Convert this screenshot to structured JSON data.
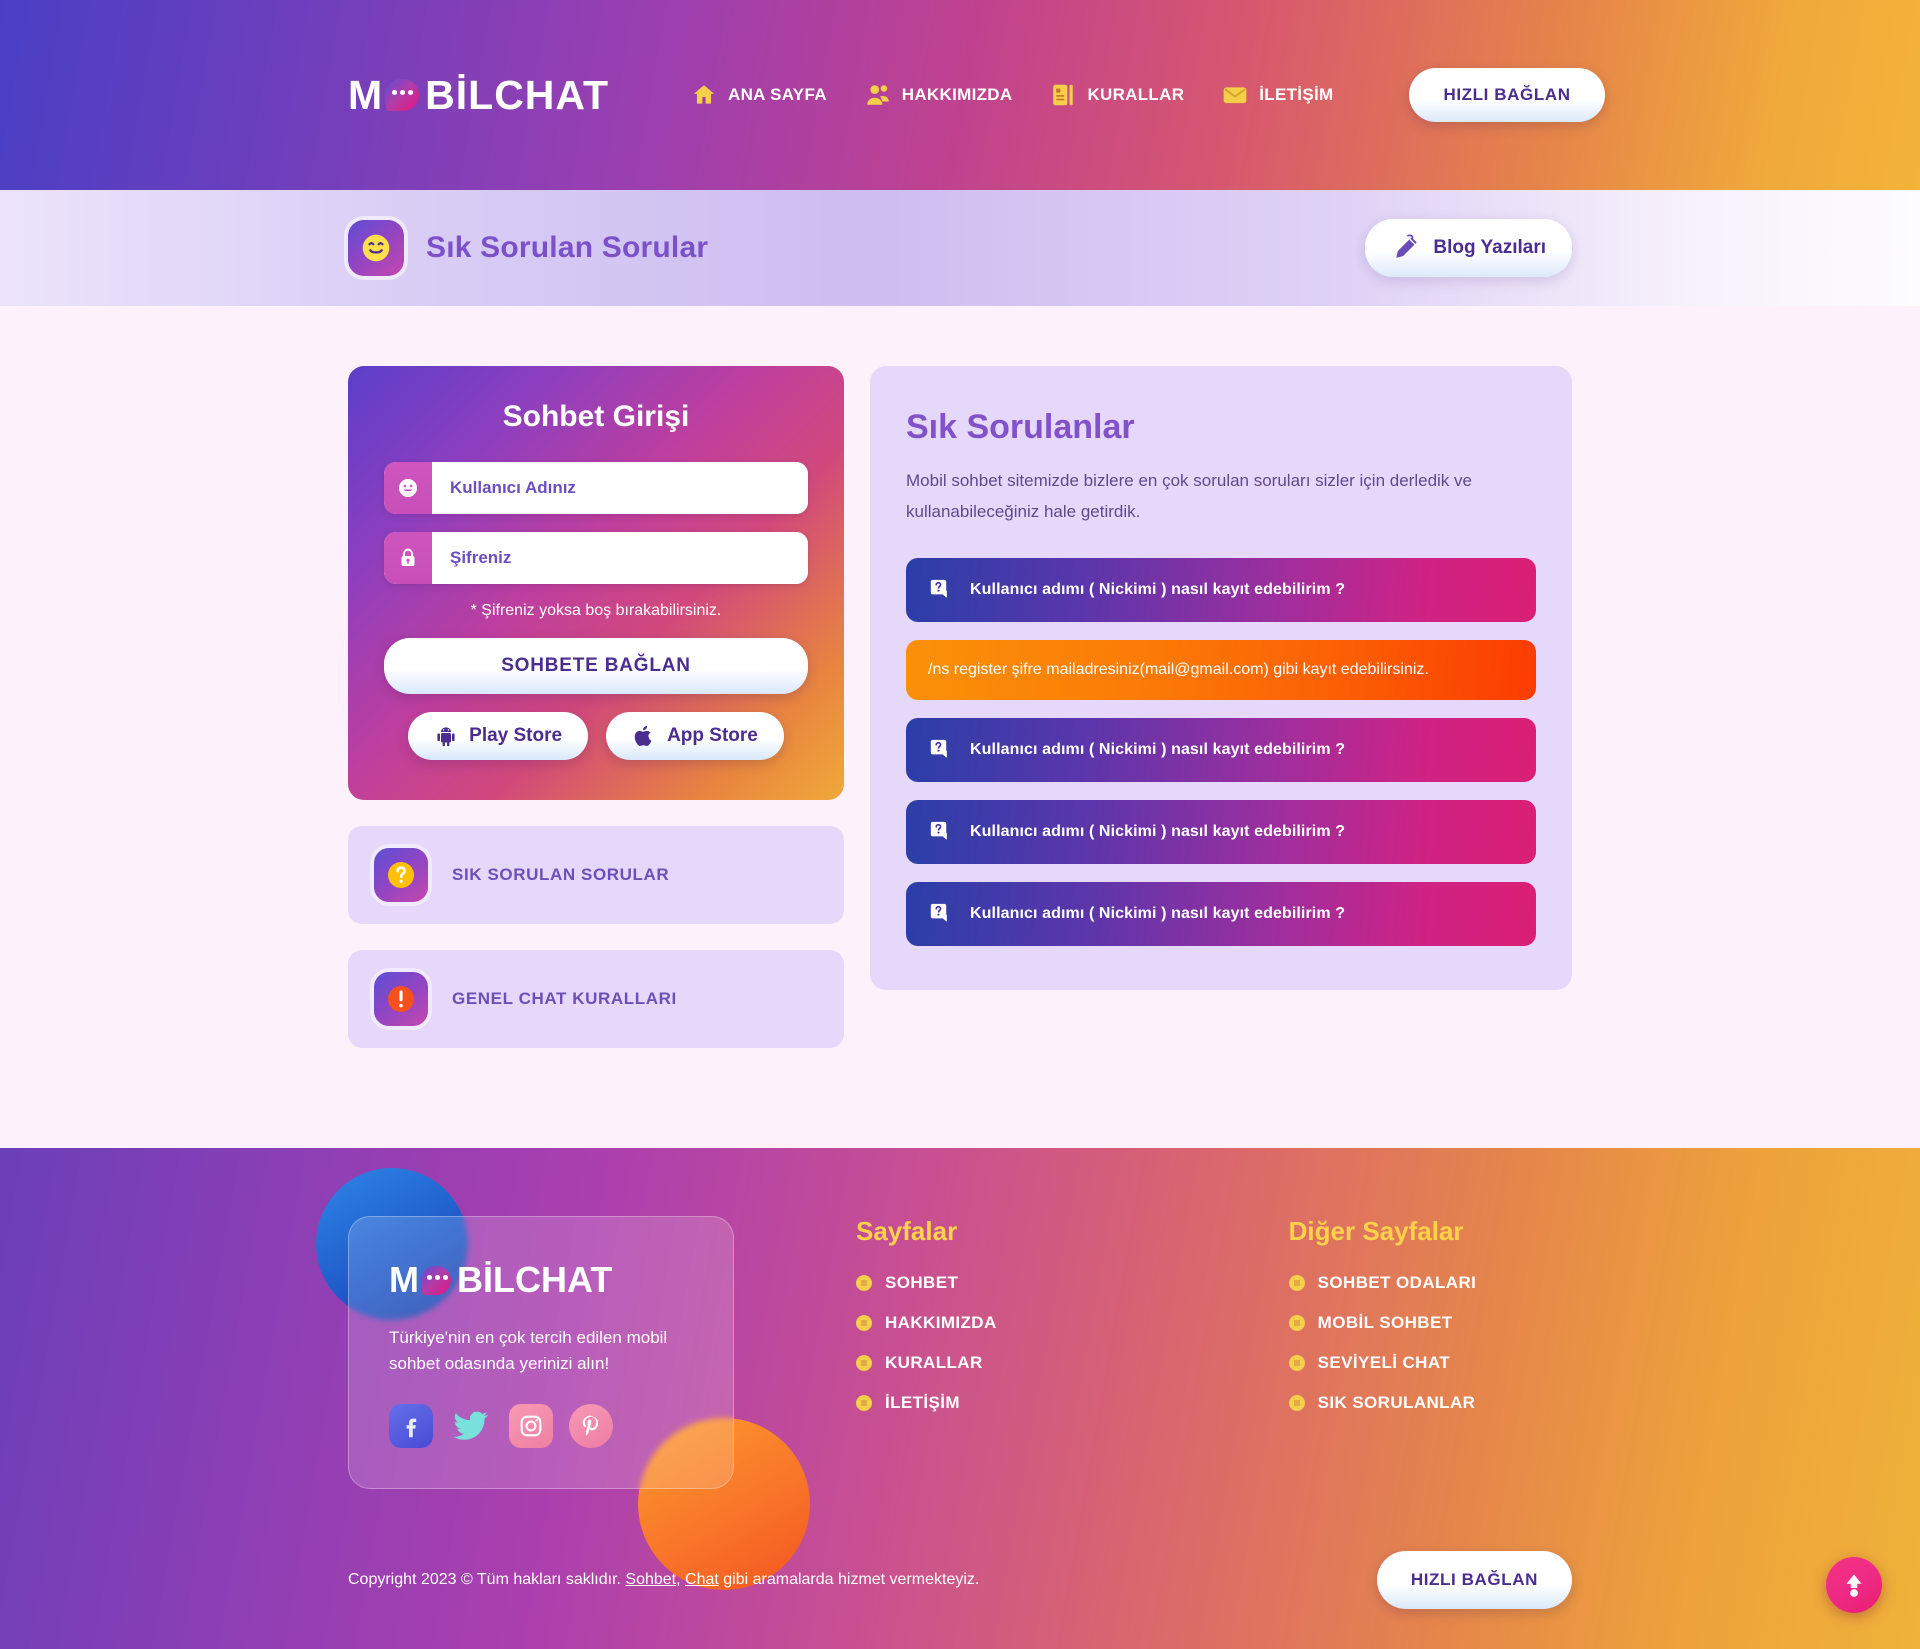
{
  "header": {
    "logo": "M BILCHAT",
    "logo_pre": "M",
    "logo_post": "BİLCHAT",
    "nav": [
      {
        "label": "ANA SAYFA",
        "icon": "home-icon"
      },
      {
        "label": "HAKKIMIZDA",
        "icon": "users-icon"
      },
      {
        "label": "KURALLAR",
        "icon": "document-icon"
      },
      {
        "label": "İLETİŞİM",
        "icon": "envelope-icon"
      }
    ],
    "quick_connect": "HIZLI BAĞLAN"
  },
  "titlebar": {
    "title": "Sık Sorulan Sorular",
    "icon": "smiley-icon",
    "blog_button": "Blog Yazıları",
    "blog_icon": "pen-icon"
  },
  "login": {
    "title": "Sohbet Girişi",
    "username_placeholder": "Kullanıcı Adınız",
    "username_value": "",
    "username_icon": "smiley-icon",
    "password_placeholder": "Şifreniz",
    "password_value": "",
    "password_icon": "lock-icon",
    "hint": "* Şifreniz yoksa boş bırakabilirsiniz.",
    "connect_button": "SOHBETE BAĞLAN",
    "play_store": "Play Store",
    "play_store_icon": "android-icon",
    "app_store": "App Store",
    "app_store_icon": "apple-icon"
  },
  "side_links": [
    {
      "label": "SIK SORULAN SORULAR",
      "icon": "question-mark-icon"
    },
    {
      "label": "GENEL CHAT KURALLARI",
      "icon": "exclamation-icon"
    }
  ],
  "faq": {
    "title": "Sık Sorulanlar",
    "description": "Mobil sohbet sitemizde bizlere en çok sorulan soruları sizler için derledik ve kullanabileceğiniz hale getirdik.",
    "items": [
      {
        "question": "Kullanıcı adımı ( Nickimi ) nasıl kayıt edebilirim ?",
        "answer": "/ns register şifre mailadresiniz(mail@gmail.com) gibi kayıt edebilirsiniz.",
        "open": true
      },
      {
        "question": "Kullanıcı adımı ( Nickimi ) nasıl kayıt edebilirim ?",
        "answer": "",
        "open": false
      },
      {
        "question": "Kullanıcı adımı ( Nickimi ) nasıl kayıt edebilirim ?",
        "answer": "",
        "open": false
      },
      {
        "question": "Kullanıcı adımı ( Nickimi ) nasıl kayıt edebilirim ?",
        "answer": "",
        "open": false
      }
    ]
  },
  "footer": {
    "logo_pre": "M",
    "logo_post": "BİLCHAT",
    "tagline": "Türkiye'nin en çok tercih edilen mobil sohbet odasında yerinizi alın!",
    "socials": [
      {
        "name": "facebook-icon"
      },
      {
        "name": "twitter-icon"
      },
      {
        "name": "instagram-icon"
      },
      {
        "name": "pinterest-icon"
      }
    ],
    "columns": [
      {
        "title": "Sayfalar",
        "links": [
          "SOHBET",
          "HAKKIMIZDA",
          "KURALLAR",
          "İLETİŞİM"
        ]
      },
      {
        "title": "Diğer Sayfalar",
        "links": [
          "SOHBET ODALARI",
          "MOBİL SOHBET",
          "SEVİYELİ CHAT",
          "SIK SORULANLAR"
        ]
      }
    ],
    "copyright_pre": "Copyright 2023 © Tüm hakları saklıdır. ",
    "copyright_link1": "Sohbet",
    "copyright_mid": ", ",
    "copyright_link2": "Chat",
    "copyright_post": " gibi aramalarda hizmet vermekteyiz.",
    "quick_connect": "HIZLI BAĞLAN",
    "to_top_icon": "arrow-up-icon"
  },
  "colors": {
    "accent_yellow": "#ffd24a",
    "purple": "#7b51c9",
    "panel": "#e6d8fa",
    "page_bg": "#fdf2fb",
    "answer_orange": "#fb7b07",
    "pink": "#e81f6e"
  }
}
